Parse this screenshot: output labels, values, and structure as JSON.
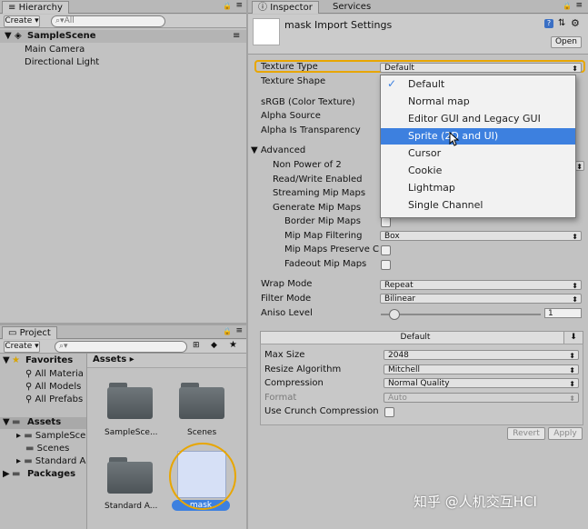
{
  "hierarchy": {
    "tab_label": "Hierarchy",
    "create_label": "Create",
    "search_placeholder": "All",
    "scene_name": "SampleScene",
    "objects": [
      "Main Camera",
      "Directional Light"
    ]
  },
  "inspector": {
    "tabs": [
      "Inspector",
      "Services"
    ],
    "title": "mask Import Settings",
    "open_label": "Open",
    "texture_type": {
      "label": "Texture Type",
      "value": "Default"
    },
    "labels": {
      "texture_shape": "Texture Shape",
      "srgb": "sRGB (Color Texture)",
      "alpha_source": "Alpha Source",
      "alpha_is_transparency": "Alpha Is Transparency",
      "advanced": "Advanced",
      "non_power_of_2": "Non Power of 2",
      "read_write": "Read/Write Enabled",
      "streaming_mip_maps": "Streaming Mip Maps",
      "generate_mip_maps": "Generate Mip Maps",
      "border_mip_maps": "Border Mip Maps",
      "mip_map_filtering": "Mip Map Filtering",
      "mip_maps_preserve": "Mip Maps Preserve C",
      "fadeout_mip_maps": "Fadeout Mip Maps",
      "wrap_mode": "Wrap Mode",
      "filter_mode": "Filter Mode",
      "aniso_level": "Aniso Level"
    },
    "values": {
      "mip_map_filtering": "Box",
      "wrap_mode": "Repeat",
      "filter_mode": "Bilinear",
      "aniso_level": "1"
    },
    "platform_tab": "Default",
    "platform": {
      "max_size": {
        "label": "Max Size",
        "value": "2048"
      },
      "resize_algorithm": {
        "label": "Resize Algorithm",
        "value": "Mitchell"
      },
      "compression": {
        "label": "Compression",
        "value": "Normal Quality"
      },
      "format": {
        "label": "Format",
        "value": "Auto"
      },
      "use_crunch": {
        "label": "Use Crunch Compression"
      }
    },
    "revert_label": "Revert",
    "apply_label": "Apply"
  },
  "texture_type_menu": {
    "items": [
      "Default",
      "Normal map",
      "Editor GUI and Legacy GUI",
      "Sprite (2D and UI)",
      "Cursor",
      "Cookie",
      "Lightmap",
      "Single Channel"
    ],
    "checked_index": 0,
    "highlighted_index": 3
  },
  "project": {
    "tab_label": "Project",
    "create_label": "Create",
    "favorites_label": "Favorites",
    "favorites": [
      "All Materia",
      "All Models",
      "All Prefabs"
    ],
    "assets_label": "Assets",
    "asset_folders": [
      "SampleSce",
      "Scenes",
      "Standard A"
    ],
    "packages_label": "Packages",
    "breadcrumb": "Assets",
    "grid_items": [
      "SampleSce...",
      "Scenes",
      "Standard A...",
      "mask"
    ]
  },
  "watermark": "知乎 @人机交互HCI",
  "colors": {
    "accent_orange": "#e8a600",
    "selection_blue": "#3d80df"
  }
}
